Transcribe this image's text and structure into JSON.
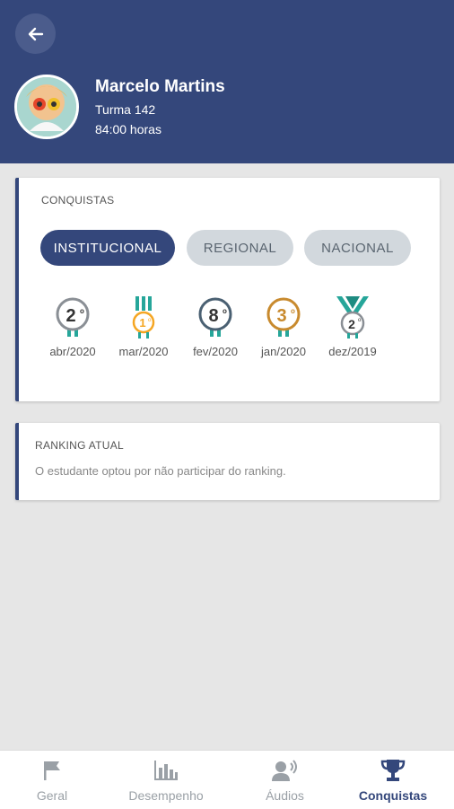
{
  "header": {
    "back_icon": "arrow-left-icon",
    "background_color": "#34477b"
  },
  "profile": {
    "name": "Marcelo Martins",
    "class": "Turma 142",
    "hours": "84:00 horas",
    "avatar": "avatar-photo"
  },
  "achievements": {
    "title": "CONQUISTAS",
    "tabs": [
      {
        "label": "INSTITUCIONAL",
        "active": true
      },
      {
        "label": "REGIONAL",
        "active": false
      },
      {
        "label": "NACIONAL",
        "active": false
      }
    ],
    "medals": [
      {
        "rank": "2",
        "date": "abr/2020",
        "style": "silver-plain"
      },
      {
        "rank": "1",
        "date": "mar/2020",
        "style": "gold-ribbon"
      },
      {
        "rank": "8",
        "date": "fev/2020",
        "style": "slate-plain"
      },
      {
        "rank": "3",
        "date": "jan/2020",
        "style": "bronze-plain"
      },
      {
        "rank": "2",
        "date": "dez/2019",
        "style": "silver-ribbon"
      }
    ]
  },
  "ranking": {
    "title": "RANKING ATUAL",
    "message": "O estudante optou por não participar do ranking."
  },
  "bottom_nav": {
    "items": [
      {
        "label": "Geral",
        "icon": "flag-icon",
        "active": false
      },
      {
        "label": "Desempenho",
        "icon": "bar-chart-icon",
        "active": false
      },
      {
        "label": "Áudios",
        "icon": "audio-user-icon",
        "active": false
      },
      {
        "label": "Conquistas",
        "icon": "trophy-icon",
        "active": true
      }
    ]
  },
  "colors": {
    "primary": "#34477b",
    "teal": "#26a69a",
    "gold": "#f5a623",
    "bronze": "#c88a2e",
    "silver": "#8a8f95",
    "slate": "#4a6072"
  }
}
